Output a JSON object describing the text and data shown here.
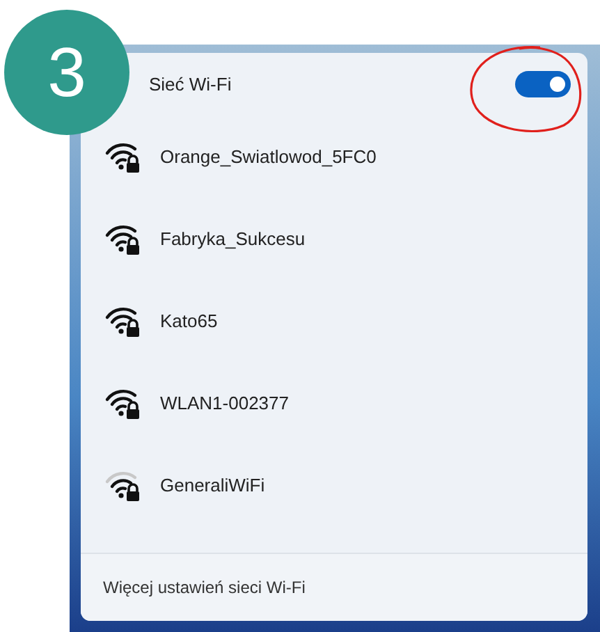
{
  "step_badge": "3",
  "wifi_panel": {
    "title": "Sieć Wi-Fi",
    "wifi_on": true,
    "networks": [
      {
        "name": "Orange_Swiatlowod_5FC0",
        "weak_signal": false,
        "secured": true
      },
      {
        "name": "Fabryka_Sukcesu",
        "weak_signal": false,
        "secured": true
      },
      {
        "name": "Kato65",
        "weak_signal": false,
        "secured": true
      },
      {
        "name": "WLAN1-002377",
        "weak_signal": false,
        "secured": true
      },
      {
        "name": "GeneraliWiFi",
        "weak_signal": true,
        "secured": true
      }
    ],
    "footer_link": "Więcej ustawień sieci Wi-Fi"
  }
}
